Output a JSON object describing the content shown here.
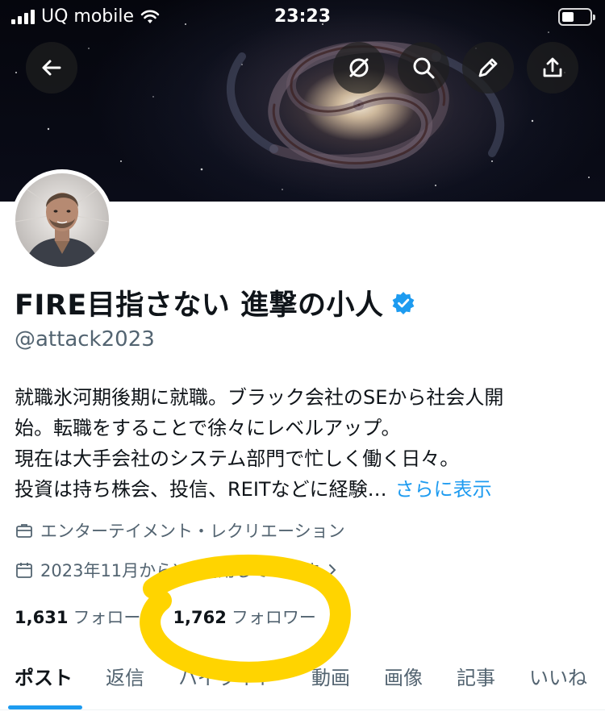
{
  "status_bar": {
    "carrier": "UQ mobile",
    "time": "23:23"
  },
  "banner_buttons": {
    "back": "back-arrow-icon",
    "mute": "mute-icon",
    "search": "search-icon",
    "edit": "pencil-icon",
    "share": "share-icon"
  },
  "profile": {
    "name": "FIRE目指さない 進撃の小人",
    "handle": "@attack2023",
    "verified": true,
    "bio_lines": [
      "就職氷河期後期に就職。ブラック会社のSEから社会人開",
      "始。転職をすることで徐々にレベルアップ。",
      "現在は大手会社のシステム部門で忙しく働く日々。",
      "投資は持ち株会、投信、REITなどに経験…"
    ],
    "show_more": "さらに表示",
    "category": "エンターテイメント・レクリエーション",
    "joined": "2023年11月からXを利用しています",
    "following_count": "1,631",
    "following_label": "フォロー",
    "followers_count": "1,762",
    "followers_label": "フォロワー"
  },
  "tabs": [
    {
      "label": "ポスト",
      "active": true
    },
    {
      "label": "返信",
      "active": false
    },
    {
      "label": "ハイライト",
      "active": false
    },
    {
      "label": "動画",
      "active": false
    },
    {
      "label": "画像",
      "active": false
    },
    {
      "label": "記事",
      "active": false
    },
    {
      "label": "いいね",
      "active": false
    }
  ],
  "colors": {
    "accent": "#1d9bf0",
    "highlight_marker": "#ffd400",
    "secondary_text": "#536471"
  }
}
